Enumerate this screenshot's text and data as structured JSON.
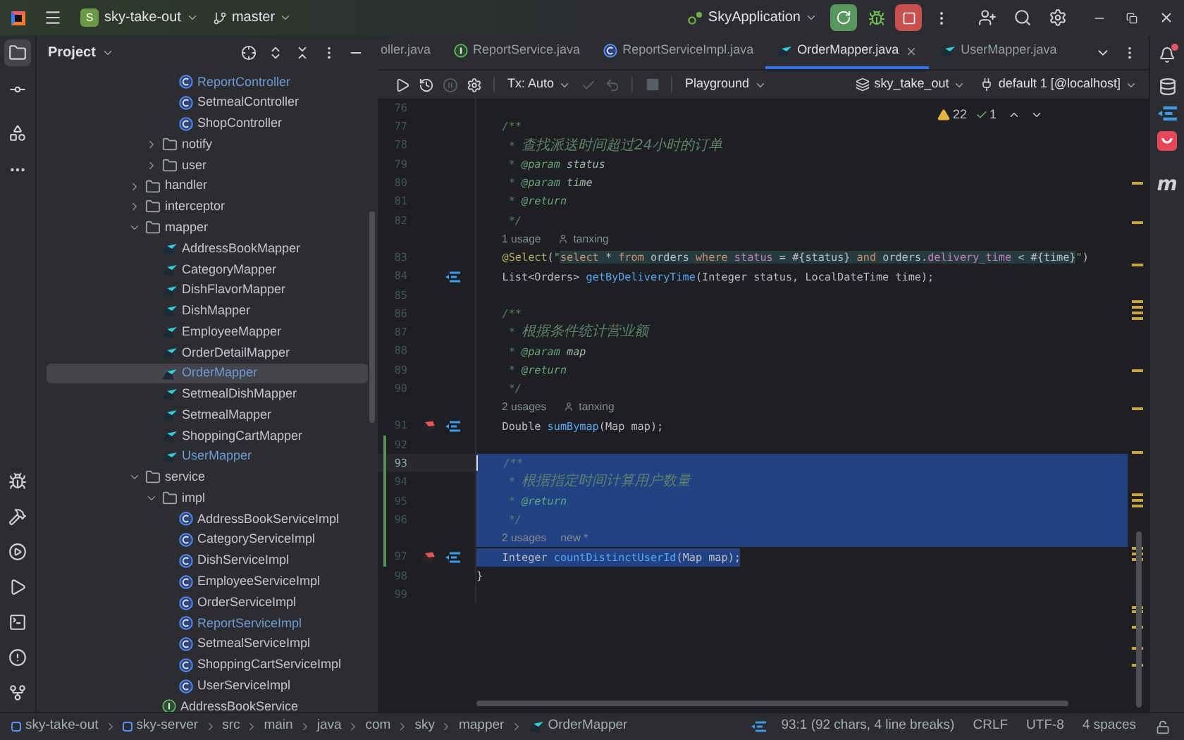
{
  "title_bar": {
    "project_badge": "S",
    "project": "sky-take-out",
    "branch": "master",
    "run_config": "SkyApplication"
  },
  "left_toolbar": [
    {
      "kind": "project",
      "selected": true
    },
    {
      "kind": "commit",
      "selected": false
    },
    {
      "kind": "structure",
      "selected": false
    },
    {
      "kind": "more",
      "selected": false
    }
  ],
  "left_toolbar_bottom": [
    {
      "kind": "debug"
    },
    {
      "kind": "build"
    },
    {
      "kind": "services"
    },
    {
      "kind": "run"
    },
    {
      "kind": "terminal"
    },
    {
      "kind": "problems"
    },
    {
      "kind": "git"
    }
  ],
  "project_panel": {
    "title": "Project",
    "tree": [
      {
        "children": [
          {
            "children": [
              {
                "label": "ReportController",
                "kind": "class",
                "selected": false,
                "modified": true
              },
              {
                "label": "SetmealController",
                "kind": "class",
                "selected": false,
                "modified": false
              },
              {
                "label": "ShopController",
                "kind": "class",
                "selected": false,
                "modified": false
              }
            ]
          },
          {
            "label": "notify",
            "kind": "folder",
            "expanded": false,
            "selected": false,
            "modified": false
          },
          {
            "label": "user",
            "kind": "folder",
            "expanded": false,
            "selected": false,
            "modified": false
          }
        ]
      },
      {
        "label": "handler",
        "kind": "folder",
        "expanded": false,
        "selected": false,
        "modified": false
      },
      {
        "label": "interceptor",
        "kind": "folder",
        "expanded": false,
        "selected": false,
        "modified": false
      },
      {
        "label": "mapper",
        "kind": "folder",
        "expanded": true,
        "selected": false,
        "modified": false,
        "children": [
          {
            "label": "AddressBookMapper",
            "kind": "mapper",
            "selected": false,
            "modified": false
          },
          {
            "label": "CategoryMapper",
            "kind": "mapper",
            "selected": false,
            "modified": false
          },
          {
            "label": "DishFlavorMapper",
            "kind": "mapper",
            "selected": false,
            "modified": false
          },
          {
            "label": "DishMapper",
            "kind": "mapper",
            "selected": false,
            "modified": false
          },
          {
            "label": "EmployeeMapper",
            "kind": "mapper",
            "selected": false,
            "modified": false
          },
          {
            "label": "OrderDetailMapper",
            "kind": "mapper",
            "selected": false,
            "modified": false
          },
          {
            "label": "OrderMapper",
            "kind": "mapper",
            "selected": true,
            "modified": true
          },
          {
            "label": "SetmealDishMapper",
            "kind": "mapper",
            "selected": false,
            "modified": false
          },
          {
            "label": "SetmealMapper",
            "kind": "mapper",
            "selected": false,
            "modified": false
          },
          {
            "label": "ShoppingCartMapper",
            "kind": "mapper",
            "selected": false,
            "modified": false
          },
          {
            "label": "UserMapper",
            "kind": "mapper",
            "selected": false,
            "modified": true
          }
        ]
      },
      {
        "label": "service",
        "kind": "folder",
        "expanded": true,
        "selected": false,
        "modified": false,
        "children": [
          {
            "label": "impl",
            "kind": "folder",
            "expanded": true,
            "selected": false,
            "modified": false,
            "children": [
              {
                "label": "AddressBookServiceImpl",
                "kind": "class",
                "selected": false,
                "modified": false
              },
              {
                "label": "CategoryServiceImpl",
                "kind": "class",
                "selected": false,
                "modified": false
              },
              {
                "label": "DishServiceImpl",
                "kind": "class",
                "selected": false,
                "modified": false
              },
              {
                "label": "EmployeeServiceImpl",
                "kind": "class",
                "selected": false,
                "modified": false
              },
              {
                "label": "OrderServiceImpl",
                "kind": "class",
                "selected": false,
                "modified": false
              },
              {
                "label": "ReportServiceImpl",
                "kind": "class",
                "selected": false,
                "modified": true
              },
              {
                "label": "SetmealServiceImpl",
                "kind": "class",
                "selected": false,
                "modified": false
              },
              {
                "label": "ShoppingCartServiceImpl",
                "kind": "class",
                "selected": false,
                "modified": false
              },
              {
                "label": "UserServiceImpl",
                "kind": "class",
                "selected": false,
                "modified": false
              }
            ]
          },
          {
            "label": "AddressBookService",
            "kind": "interface",
            "selected": false,
            "modified": false
          }
        ]
      }
    ]
  },
  "tabs": [
    {
      "label": "oller.java",
      "kind": "partial",
      "selected": false
    },
    {
      "label": "ReportService.java",
      "kind": "interface",
      "selected": false
    },
    {
      "label": "ReportServiceImpl.java",
      "kind": "class",
      "selected": false
    },
    {
      "label": "OrderMapper.java",
      "kind": "mapper",
      "selected": true
    },
    {
      "label": "UserMapper.java",
      "kind": "mapper",
      "selected": false
    }
  ],
  "editor_toolbar": {
    "actions": [
      {
        "kind": "run",
        "disabled": false
      },
      {
        "kind": "history",
        "disabled": false
      },
      {
        "kind": "pause",
        "disabled": true
      },
      {
        "kind": "settings",
        "disabled": false
      },
      {
        "kind": "divider"
      },
      {
        "kind": "dropdown",
        "label": "Tx: Auto",
        "disabled": false
      },
      {
        "kind": "commit",
        "disabled": true
      },
      {
        "kind": "rollback",
        "disabled": true
      },
      {
        "kind": "divider"
      },
      {
        "kind": "stop",
        "disabled": true
      },
      {
        "kind": "divider"
      },
      {
        "kind": "dropdown",
        "label": "Playground",
        "disabled": false
      }
    ],
    "schema": "sky_take_out",
    "datasource": "default 1 [@localhost]"
  },
  "inspections": {
    "warnings": "22",
    "ok": "1"
  },
  "code": [
    {
      "kind": "code",
      "number": "76",
      "line_selected": false,
      "current": false,
      "changed": false
    },
    {
      "kind": "code",
      "number": "77",
      "line_selected": false,
      "text_selected": false,
      "current": false,
      "changed": false,
      "tokens": [
        {
          "text": "    /**",
          "kind": "doc"
        }
      ]
    },
    {
      "kind": "code",
      "number": "78",
      "line_selected": false,
      "text_selected": false,
      "current": false,
      "changed": false,
      "tokens": [
        {
          "text": "     * ",
          "kind": "doc"
        },
        {
          "text": "查找派送时间超过24小时的订单",
          "kind": "doc-cn"
        }
      ]
    },
    {
      "kind": "code",
      "number": "79",
      "line_selected": false,
      "text_selected": false,
      "current": false,
      "changed": false,
      "tokens": [
        {
          "text": "     * ",
          "kind": "doc"
        },
        {
          "text": "@param",
          "kind": "doctag"
        },
        {
          "text": " status",
          "kind": "docparam"
        }
      ]
    },
    {
      "kind": "code",
      "number": "80",
      "line_selected": false,
      "text_selected": false,
      "current": false,
      "changed": false,
      "tokens": [
        {
          "text": "     * ",
          "kind": "doc"
        },
        {
          "text": "@param",
          "kind": "doctag"
        },
        {
          "text": " time",
          "kind": "docparam"
        }
      ]
    },
    {
      "kind": "code",
      "number": "81",
      "line_selected": false,
      "text_selected": false,
      "current": false,
      "changed": false,
      "tokens": [
        {
          "text": "     * ",
          "kind": "doc"
        },
        {
          "text": "@return",
          "kind": "doctag"
        }
      ]
    },
    {
      "kind": "code",
      "number": "82",
      "line_selected": false,
      "text_selected": false,
      "current": false,
      "changed": false,
      "tokens": [
        {
          "text": "     */",
          "kind": "doc"
        }
      ]
    },
    {
      "kind": "hint",
      "usages": "1 usage",
      "author": "tanxing",
      "line_selected": false,
      "changed": false
    },
    {
      "kind": "code",
      "number": "83",
      "line_selected": false,
      "text_selected": false,
      "current": false,
      "changed": false,
      "tokens": [
        {
          "text": "    @Select",
          "kind": "annotation"
        },
        {
          "text": "(",
          "kind": "plain"
        },
        {
          "text": "\"",
          "kind": "string"
        },
        {
          "text": "select",
          "kind": "sql-keyword"
        },
        {
          "text": " * ",
          "kind": "sql"
        },
        {
          "text": "from",
          "kind": "sql-keyword"
        },
        {
          "text": " orders ",
          "kind": "sql"
        },
        {
          "text": "where ",
          "kind": "sql-keyword"
        },
        {
          "text": "status",
          "kind": "sql-field"
        },
        {
          "text": " = #{status} ",
          "kind": "sql"
        },
        {
          "text": "and",
          "kind": "sql-keyword"
        },
        {
          "text": " orders.",
          "kind": "sql"
        },
        {
          "text": "delivery_time",
          "kind": "sql-field"
        },
        {
          "text": " < #{time}",
          "kind": "sql"
        },
        {
          "text": "\"",
          "kind": "string"
        },
        {
          "text": ")",
          "kind": "plain"
        }
      ]
    },
    {
      "kind": "code",
      "number": "84",
      "line_selected": false,
      "text_selected": false,
      "current": false,
      "changed": false,
      "gutter": [
        {
          "kind": "navigate"
        }
      ],
      "tokens": [
        {
          "text": "    List<Orders> ",
          "kind": "plain"
        },
        {
          "text": "getByDeliveryTime",
          "kind": "method"
        },
        {
          "text": "(Integer status, LocalDateTime time);",
          "kind": "plain"
        }
      ]
    },
    {
      "kind": "code",
      "number": "85",
      "line_selected": false,
      "current": false,
      "changed": false
    },
    {
      "kind": "code",
      "number": "86",
      "line_selected": false,
      "text_selected": false,
      "current": false,
      "changed": false,
      "tokens": [
        {
          "text": "    /**",
          "kind": "doc"
        }
      ]
    },
    {
      "kind": "code",
      "number": "87",
      "line_selected": false,
      "text_selected": false,
      "current": false,
      "changed": false,
      "tokens": [
        {
          "text": "     * ",
          "kind": "doc"
        },
        {
          "text": "根据条件统计营业额",
          "kind": "doc-cn"
        }
      ]
    },
    {
      "kind": "code",
      "number": "88",
      "line_selected": false,
      "text_selected": false,
      "current": false,
      "changed": false,
      "tokens": [
        {
          "text": "     * ",
          "kind": "doc"
        },
        {
          "text": "@param",
          "kind": "doctag"
        },
        {
          "text": " map",
          "kind": "docparam"
        }
      ]
    },
    {
      "kind": "code",
      "number": "89",
      "line_selected": false,
      "text_selected": false,
      "current": false,
      "changed": false,
      "tokens": [
        {
          "text": "     * ",
          "kind": "doc"
        },
        {
          "text": "@return",
          "kind": "doctag"
        }
      ]
    },
    {
      "kind": "code",
      "number": "90",
      "line_selected": false,
      "text_selected": false,
      "current": false,
      "changed": false,
      "tokens": [
        {
          "text": "     */",
          "kind": "doc"
        }
      ]
    },
    {
      "kind": "hint",
      "usages": "2 usages",
      "author": "tanxing",
      "line_selected": false,
      "changed": false
    },
    {
      "kind": "code",
      "number": "91",
      "line_selected": false,
      "text_selected": false,
      "current": false,
      "changed": false,
      "gutter": [
        {
          "kind": "bird"
        },
        {
          "kind": "navigate"
        }
      ],
      "tokens": [
        {
          "text": "    Double ",
          "kind": "plain"
        },
        {
          "text": "sumBymap",
          "kind": "method"
        },
        {
          "text": "(Map map);",
          "kind": "plain"
        }
      ]
    },
    {
      "kind": "code",
      "number": "92",
      "line_selected": false,
      "current": false,
      "changed": true
    },
    {
      "kind": "code",
      "number": "93",
      "line_selected": true,
      "text_selected": false,
      "current": true,
      "changed": true,
      "tokens": [
        {
          "text": "    /**",
          "kind": "doc"
        }
      ]
    },
    {
      "kind": "code",
      "number": "94",
      "line_selected": true,
      "text_selected": false,
      "current": false,
      "changed": true,
      "tokens": [
        {
          "text": "     * ",
          "kind": "doc"
        },
        {
          "text": "根据指定时间计算用户数量",
          "kind": "doc-cn"
        }
      ]
    },
    {
      "kind": "code",
      "number": "95",
      "line_selected": true,
      "text_selected": false,
      "current": false,
      "changed": true,
      "tokens": [
        {
          "text": "     * ",
          "kind": "doc"
        },
        {
          "text": "@return",
          "kind": "doctag"
        }
      ]
    },
    {
      "kind": "code",
      "number": "96",
      "line_selected": true,
      "text_selected": false,
      "current": false,
      "changed": true,
      "tokens": [
        {
          "text": "     */",
          "kind": "doc"
        }
      ]
    },
    {
      "kind": "hint",
      "usages": "2 usages",
      "note": "new *",
      "line_selected": true,
      "changed": true
    },
    {
      "kind": "code",
      "number": "97",
      "line_selected": false,
      "text_selected": true,
      "current": false,
      "changed": true,
      "gutter": [
        {
          "kind": "bird"
        },
        {
          "kind": "navigate"
        }
      ],
      "tokens": [
        {
          "text": "    Integer ",
          "kind": "plain"
        },
        {
          "text": "countDistinctUserId",
          "kind": "method"
        },
        {
          "text": "(Map map);",
          "kind": "plain"
        }
      ]
    },
    {
      "kind": "code",
      "number": "98",
      "line_selected": false,
      "text_selected": false,
      "current": false,
      "changed": false,
      "tokens": [
        {
          "text": "}",
          "kind": "plain"
        }
      ]
    },
    {
      "kind": "code",
      "number": "99",
      "line_selected": false,
      "current": false,
      "changed": false
    }
  ],
  "right_toolbar": [
    {
      "kind": "database"
    },
    {
      "kind": "mapper"
    },
    {
      "kind": "app"
    },
    {
      "kind": "letter",
      "glyph": "m"
    }
  ],
  "notifications": {
    "unread": true
  },
  "status_bar": {
    "breadcrumbs": [
      {
        "label": "sky-take-out",
        "kind": "module"
      },
      {
        "label": "sky-server",
        "kind": "module"
      },
      {
        "label": "src",
        "kind": "plain"
      },
      {
        "label": "main",
        "kind": "plain"
      },
      {
        "label": "java",
        "kind": "plain"
      },
      {
        "label": "com",
        "kind": "plain"
      },
      {
        "label": "sky",
        "kind": "plain"
      },
      {
        "label": "mapper",
        "kind": "plain"
      },
      {
        "label": "OrderMapper",
        "kind": "mapper"
      }
    ],
    "position": "93:1 (92 chars, 4 line breaks)",
    "line_ending": "CRLF",
    "encoding": "UTF-8",
    "indent": "4 spaces"
  }
}
